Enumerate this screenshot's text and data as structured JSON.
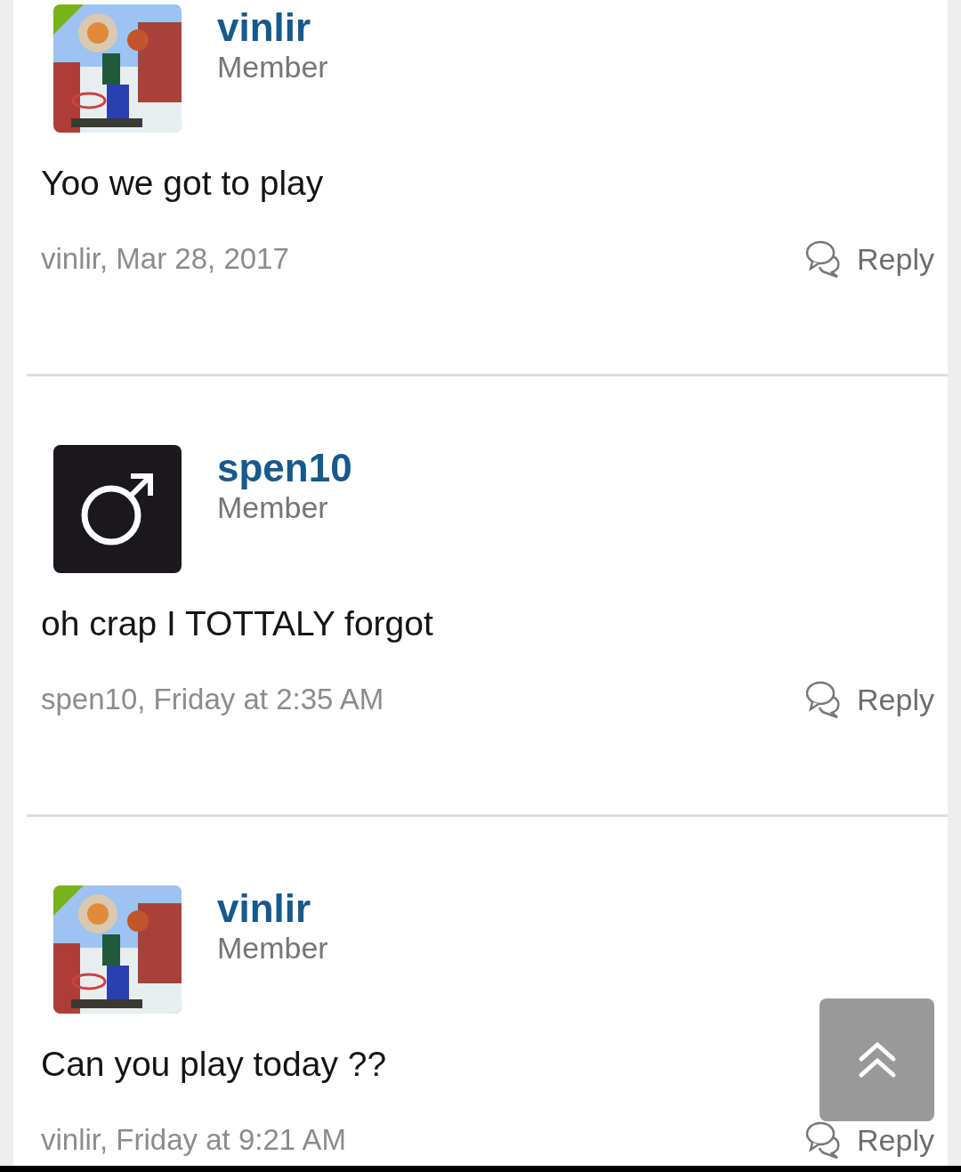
{
  "posts": [
    {
      "author": "vinlir",
      "role": "Member",
      "message": "Yoo we got to play",
      "meta": "vinlir, Mar 28, 2017",
      "reply": "Reply"
    },
    {
      "author": "spen10",
      "role": "Member",
      "avatar": {
        "kind": "symbol"
      },
      "message": "oh crap I TOTTALY forgot",
      "meta": "spen10, Friday at 2:35 AM",
      "reply": "Reply"
    },
    {
      "author": "vinlir",
      "role": "Member",
      "message": "Can you play today ??",
      "meta": "vinlir, Friday at 9:21 AM",
      "reply": "Reply"
    }
  ]
}
